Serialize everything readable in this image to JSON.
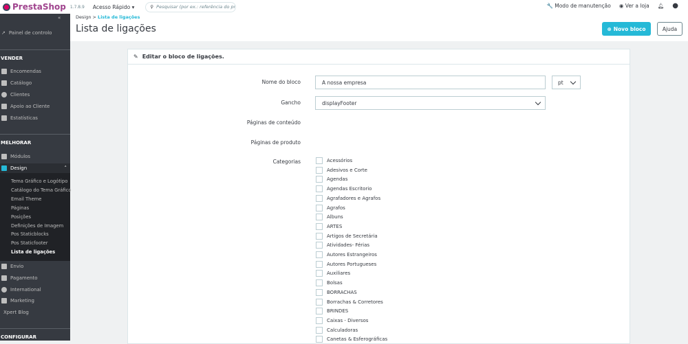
{
  "topbar": {
    "brand": "PrestaShop",
    "version": "1.7.8.9",
    "quick_access": "Acesso Rápido",
    "search_placeholder": "Pesquisar (por ex.: referência do produ",
    "maintenance": "Modo de manutenção",
    "view_store": "Ver a loja"
  },
  "sidebar": {
    "collapse": "«",
    "dashboard": "Painel de controlo",
    "sell_header": "VENDER",
    "sell": [
      "Encomendas",
      "Catálogo",
      "Clientes",
      "Apoio ao Cliente",
      "Estatísticas"
    ],
    "improve_header": "MELHORAR",
    "modules": "Módulos",
    "design": "Design",
    "design_sub": [
      "Tema Gráfico e Logótipo",
      "Catálogo do Tema Gráfico",
      "Email Theme",
      "Páginas",
      "Posições",
      "Definições de Imagem",
      "Pos Staticblocks",
      "Pos Staticfooter",
      "Lista de ligações"
    ],
    "more": [
      "Envio",
      "Pagamento",
      "International",
      "Marketing"
    ],
    "xpert": "Xpert Blog",
    "configure_header": "CONFIGURAR"
  },
  "header": {
    "breadcrumb_parent": "Design",
    "breadcrumb_current": "Lista de ligações",
    "title": "Lista de ligações",
    "new_block": "Novo bloco",
    "help": "Ajuda"
  },
  "panel": {
    "title": "Editar o bloco de ligações.",
    "name_label": "Nome do bloco",
    "name_value": "A nossa empresa",
    "lang": "pt",
    "hook_label": "Gancho",
    "hook_value": "displayFooter",
    "content_pages_label": "Páginas de conteúdo",
    "product_pages_label": "Páginas de produto",
    "categories_label": "Categorias",
    "categories": [
      "Acessórios",
      "Adesivos e Corte",
      "Agendas",
      "Agendas Escritorio",
      "Agrafadores e Agrafos",
      "Agrafos",
      "Albuns",
      "ARTES",
      "Artigos de Secretária",
      "Atividades- Férias",
      "Autores Estrangeiros",
      "Autores Portugueses",
      "Auxiliares",
      "Bolsas",
      "BORRACHAS",
      "Borrachas & Corretores",
      "BRINDES",
      "Caixas - Diversos",
      "Calculadoras",
      "Canetas & Esferográficas"
    ]
  }
}
